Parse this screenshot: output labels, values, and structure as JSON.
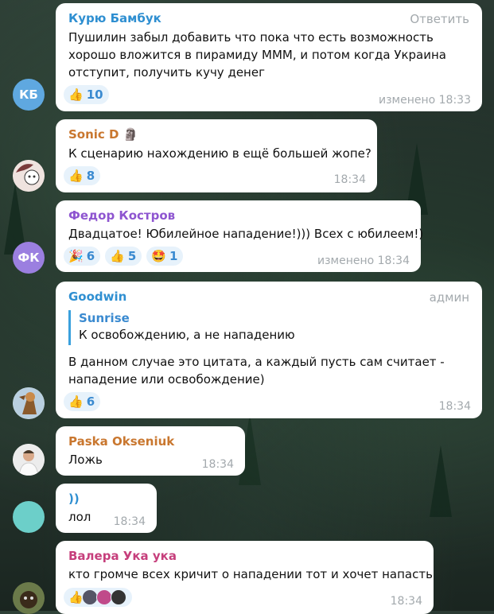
{
  "messages": [
    {
      "name": "Курю Бамбук",
      "name_color": "#2f8fd1",
      "reply_label": "Ответить",
      "lines": [
        "Пушилин забыл добавить что пока что есть возможность",
        "хорошо вложится в пирамиду МММ, и потом когда Украина",
        "отступит, получить кучу денег"
      ],
      "reactions": [
        {
          "emoji": "👍",
          "count": "10"
        }
      ],
      "time": "изменено 18:33",
      "avatar_initials": "КБ",
      "avatar_color": "#5fa8e0"
    },
    {
      "name": "Sonic D",
      "name_color": "#c9772f",
      "name_emoji": "🗿",
      "lines": [
        "К сценарию нахождению в ещё большей жопе?"
      ],
      "reactions": [
        {
          "emoji": "👍",
          "count": "8"
        }
      ],
      "time": "18:34"
    },
    {
      "name": "Федор Костров",
      "name_color": "#8e55d0",
      "lines": [
        "Двадцатое! Юбилейное нападение!))) Всех с юбилеем!)"
      ],
      "reactions": [
        {
          "emoji": "🎉",
          "count": "6"
        },
        {
          "emoji": "👍",
          "count": "5"
        },
        {
          "emoji": "🤩",
          "count": "1"
        }
      ],
      "time": "изменено 18:34",
      "avatar_initials": "ФК",
      "avatar_color": "#9b7fe0"
    },
    {
      "name": "Goodwin",
      "name_color": "#2f8fd1",
      "badge": "админ",
      "quote_name": "Sunrise",
      "quote_text": "К освобождению, а не нападению",
      "lines": [
        "В данном случае это цитата, а каждый пусть сам считает -",
        "нападение или освобождение)"
      ],
      "reactions": [
        {
          "emoji": "👍",
          "count": "6"
        }
      ],
      "time": "18:34"
    },
    {
      "name": "Paska Okseniuk",
      "name_color": "#c9772f",
      "lines": [
        "Ложь"
      ],
      "time": "18:34"
    },
    {
      "name": "))",
      "name_color": "#2f8fd1",
      "lines": [
        "лол"
      ],
      "time": "18:34",
      "avatar_color": "#6ccfc9"
    },
    {
      "name": "Валера Ука ука",
      "name_color": "#c63f7c",
      "lines": [
        "кто громче всех кричит о нападении тот и хочет напасть"
      ],
      "reactions": [
        {
          "emoji": "👍",
          "count": ""
        }
      ],
      "time": "18:34"
    }
  ]
}
